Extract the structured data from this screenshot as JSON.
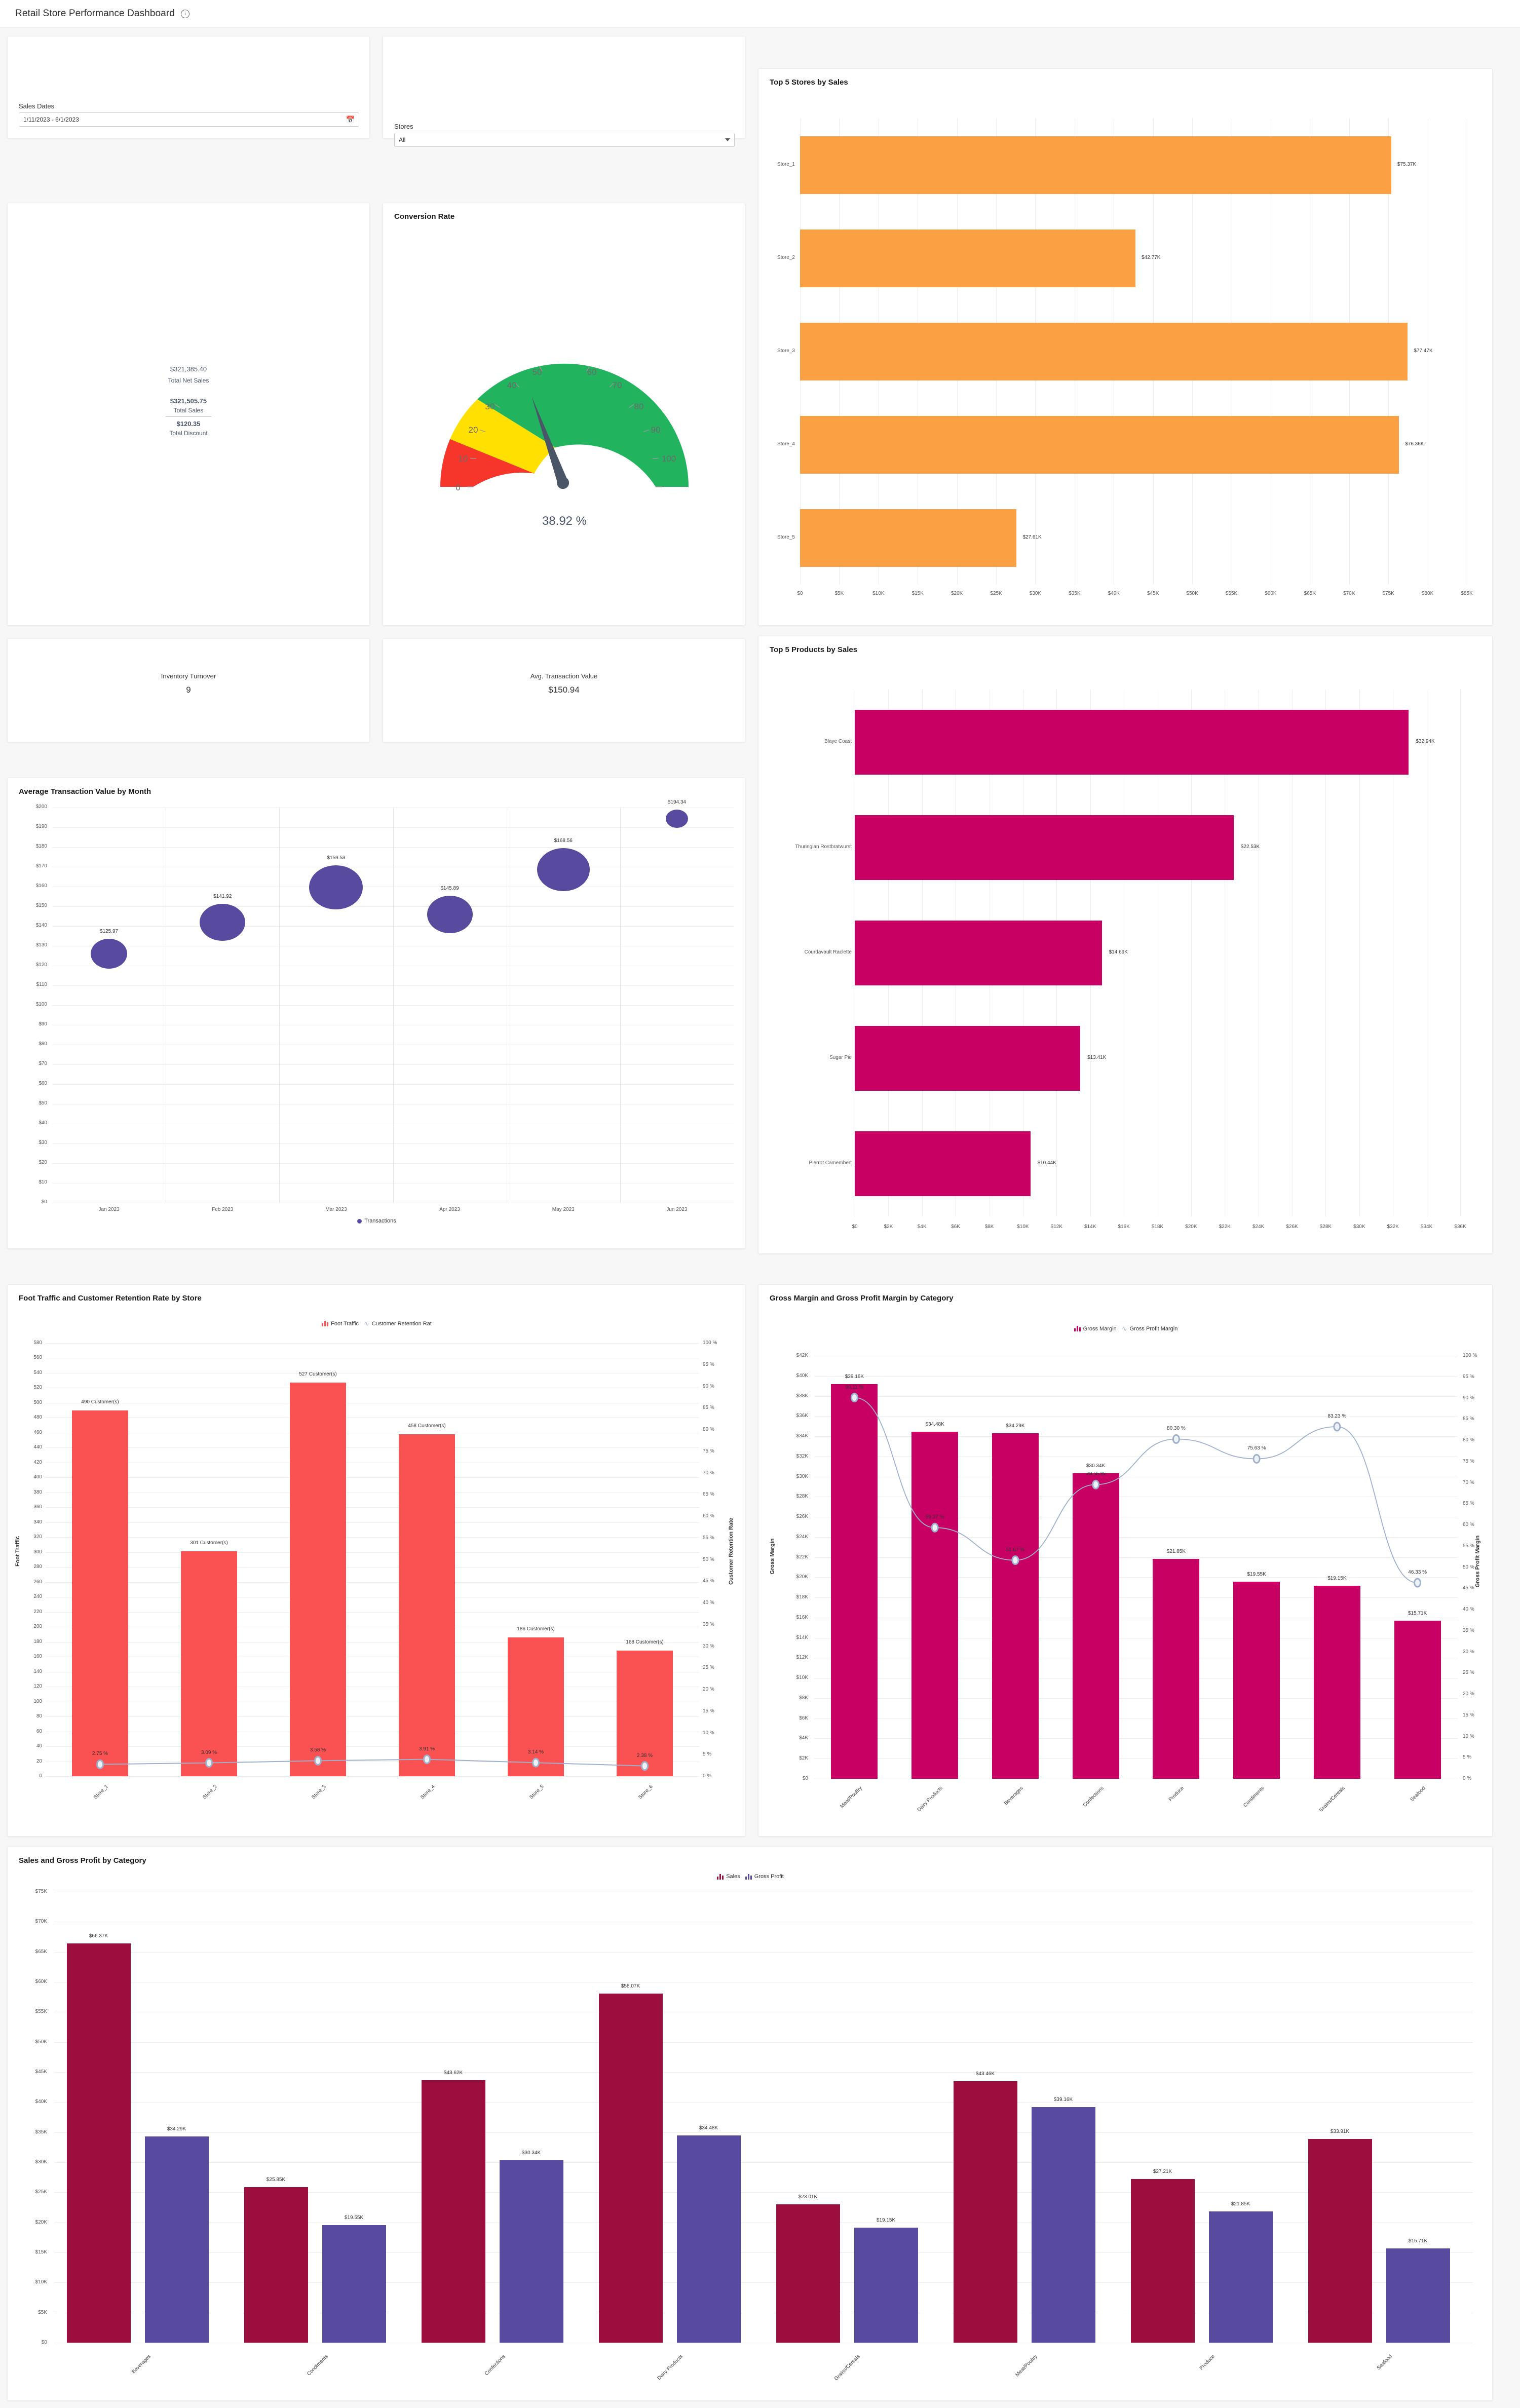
{
  "header": {
    "title": "Retail Store Performance Dashboard",
    "info_icon": "info-icon"
  },
  "filters": {
    "sales_dates": {
      "label": "Sales Dates",
      "value": "1/11/2023 - 6/1/2023",
      "icon": "calendar-icon"
    },
    "stores": {
      "label": "Stores",
      "value": "All",
      "icon": "chevron-down-icon"
    }
  },
  "kpis": {
    "net_sales_value": "$321,385.40",
    "net_sales_label": "Total Net Sales",
    "total_sales_value": "$321,505.75",
    "total_sales_label": "Total Sales",
    "discount_value": "$120.35",
    "discount_label": "Total Discount",
    "inventory_turnover_label": "Inventory Turnover",
    "inventory_turnover_value": "9",
    "atv_label": "Avg. Transaction Value",
    "atv_value": "$150.94"
  },
  "cards": {
    "conversion_rate": "Conversion Rate",
    "top_stores": "Top 5 Stores by Sales",
    "top_products": "Top 5 Products by Sales",
    "atv_month": "Average Transaction Value by Month",
    "foot_traffic": "Foot Traffic and Customer Retention Rate by Store",
    "gross_margin": "Gross Margin and Gross Profit Margin by Category",
    "sales_profit": "Sales and Gross Profit by Category"
  },
  "chart_data": [
    {
      "id": "conversion-gauge",
      "type": "gauge",
      "title": "Conversion Rate",
      "value": 38.92,
      "value_label": "38.92 %",
      "min": 0,
      "max": 100,
      "ticks": [
        0,
        10,
        20,
        30,
        40,
        50,
        60,
        70,
        80,
        90,
        100
      ],
      "bands": [
        {
          "from": 0,
          "to": 10,
          "color": "#f6352b"
        },
        {
          "from": 10,
          "to": 20,
          "color": "#ffe000"
        },
        {
          "from": 20,
          "to": 100,
          "color": "#22b35e"
        }
      ],
      "needle_color": "#4a5568"
    },
    {
      "id": "top-stores",
      "type": "bar",
      "orientation": "horizontal",
      "title": "Top 5 Stores by Sales",
      "categories": [
        "Store_1",
        "Store_2",
        "Store_3",
        "Store_4",
        "Store_5"
      ],
      "values": [
        75370,
        42770,
        77470,
        76360,
        27610
      ],
      "value_labels": [
        "$75.37K",
        "$42.77K",
        "$77.47K",
        "$76.36K",
        "$27.61K"
      ],
      "color": "#fca044",
      "xlim": [
        0,
        85000
      ],
      "xticks": [
        "$0",
        "$5K",
        "$10K",
        "$15K",
        "$20K",
        "$25K",
        "$30K",
        "$35K",
        "$40K",
        "$45K",
        "$50K",
        "$55K",
        "$60K",
        "$65K",
        "$70K",
        "$75K",
        "$80K",
        "$85K"
      ],
      "grid": true
    },
    {
      "id": "top-products",
      "type": "bar",
      "orientation": "horizontal",
      "title": "Top 5 Products by Sales",
      "categories": [
        "Blaye Coast",
        "Thuringian Rostbratwurst",
        "Courdavault Raclette",
        "Sugar Pie",
        "Pierrot Camembert"
      ],
      "values": [
        32940,
        22530,
        14690,
        13410,
        10440
      ],
      "value_labels": [
        "$32.94K",
        "$22.53K",
        "$14.69K",
        "$13.41K",
        "$10.44K"
      ],
      "color": "#c80063",
      "xlim": [
        0,
        36000
      ],
      "xticks": [
        "$0",
        "$2K",
        "$4K",
        "$6K",
        "$8K",
        "$10K",
        "$12K",
        "$14K",
        "$16K",
        "$18K",
        "$20K",
        "$22K",
        "$24K",
        "$26K",
        "$28K",
        "$30K",
        "$32K",
        "$34K",
        "$36K"
      ],
      "grid": true
    },
    {
      "id": "atv-by-month",
      "type": "scatter",
      "title": "Average Transaction Value by Month",
      "categories": [
        "Jan 2023",
        "Feb 2023",
        "Mar 2023",
        "Apr 2023",
        "May 2023",
        "Jun 2023"
      ],
      "values": [
        125.97,
        141.92,
        159.53,
        145.89,
        168.56,
        194.34
      ],
      "value_labels": [
        "$125.97",
        "$141.92",
        "$159.53",
        "$145.89",
        "$168.56",
        "$194.34"
      ],
      "bubble_sizes": [
        36,
        45,
        53,
        45,
        52,
        22
      ],
      "color": "#584a9e",
      "ylim": [
        0,
        200
      ],
      "yticks": [
        "$0",
        "$10",
        "$20",
        "$30",
        "$40",
        "$50",
        "$60",
        "$70",
        "$80",
        "$90",
        "$100",
        "$110",
        "$120",
        "$130",
        "$140",
        "$150",
        "$160",
        "$170",
        "$180",
        "$190",
        "$200"
      ],
      "legend": [
        "Transactions"
      ],
      "grid": true
    },
    {
      "id": "foot-traffic-retention",
      "type": "bar",
      "title": "Foot Traffic and Customer Retention Rate by Store",
      "categories": [
        "Store_1",
        "Store_2",
        "Store_3",
        "Store_4",
        "Store_5",
        "Store_6"
      ],
      "series": [
        {
          "name": "Foot Traffic",
          "type": "bar",
          "color": "#fa5252",
          "values": [
            490,
            301,
            527,
            458,
            186,
            168
          ],
          "value_labels": [
            "490 Customer(s)",
            "301 Customer(s)",
            "527 Customer(s)",
            "458 Customer(s)",
            "186 Customer(s)",
            "168 Customer(s)"
          ]
        },
        {
          "name": "Customer Retention Rat",
          "type": "line",
          "color": "#9db0cc",
          "values": [
            2.75,
            3.09,
            3.58,
            3.91,
            3.14,
            2.38
          ],
          "value_labels": [
            "2.75 %",
            "3.09 %",
            "3.58 %",
            "3.91 %",
            "3.14 %",
            "2.38 %"
          ]
        }
      ],
      "ylabel": "Foot Traffic",
      "y2label": "Customer Retention Rate",
      "ylim": [
        0,
        580
      ],
      "yticks": [
        "0",
        "20",
        "40",
        "60",
        "80",
        "100",
        "120",
        "140",
        "160",
        "180",
        "200",
        "220",
        "240",
        "260",
        "280",
        "300",
        "320",
        "340",
        "360",
        "380",
        "400",
        "420",
        "440",
        "460",
        "480",
        "500",
        "520",
        "540",
        "560",
        "580"
      ],
      "y2lim": [
        0,
        100
      ],
      "y2ticks": [
        "0 %",
        "5 %",
        "10 %",
        "15 %",
        "20 %",
        "25 %",
        "30 %",
        "35 %",
        "40 %",
        "45 %",
        "50 %",
        "55 %",
        "60 %",
        "65 %",
        "70 %",
        "75 %",
        "80 %",
        "85 %",
        "90 %",
        "95 %",
        "100 %"
      ],
      "grid": true
    },
    {
      "id": "gross-margin-category",
      "type": "bar",
      "title": "Gross Margin and Gross Profit Margin by Category",
      "categories": [
        "Meat/Poultry",
        "Dairy Products",
        "Beverages",
        "Confections",
        "Produce",
        "Condiments",
        "Grains/Cereals",
        "Seafood"
      ],
      "series": [
        {
          "name": "Gross Margin",
          "type": "bar",
          "color": "#c80063",
          "values": [
            39160,
            34480,
            34290,
            30340,
            21850,
            19550,
            19150,
            15710
          ],
          "value_labels": [
            "$39.16K",
            "$34.48K",
            "$34.29K",
            "$30.34K",
            "$21.85K",
            "$19.55K",
            "$19.15K",
            "$15.71K"
          ]
        },
        {
          "name": "Gross Profit Margin",
          "type": "line",
          "color": "#9db0cc",
          "values": [
            90.11,
            59.37,
            51.67,
            69.55,
            80.3,
            75.63,
            83.23,
            46.33
          ],
          "value_labels": [
            "90.11 %",
            "59.37 %",
            "51.67 %",
            "69.55 %",
            "80.30 %",
            "75.63 %",
            "83.23 %",
            "46.33 %"
          ]
        }
      ],
      "ylabel": "Gross Margin",
      "y2label": "Gross Profit Margin",
      "ylim": [
        0,
        42000
      ],
      "yticks": [
        "$0",
        "$2K",
        "$4K",
        "$6K",
        "$8K",
        "$10K",
        "$12K",
        "$14K",
        "$16K",
        "$18K",
        "$20K",
        "$22K",
        "$24K",
        "$26K",
        "$28K",
        "$30K",
        "$32K",
        "$34K",
        "$36K",
        "$38K",
        "$40K",
        "$42K"
      ],
      "y2lim": [
        0,
        100
      ],
      "y2ticks": [
        "0 %",
        "5 %",
        "10 %",
        "15 %",
        "20 %",
        "25 %",
        "30 %",
        "35 %",
        "40 %",
        "45 %",
        "50 %",
        "55 %",
        "60 %",
        "65 %",
        "70 %",
        "75 %",
        "80 %",
        "85 %",
        "90 %",
        "95 %",
        "100 %"
      ],
      "grid": true
    },
    {
      "id": "sales-gross-profit-category",
      "type": "bar",
      "title": "Sales and Gross Profit by Category",
      "categories": [
        "Beverages",
        "Condiments",
        "Confections",
        "Dairy Products",
        "Grains/Cereals",
        "Meat/Poultry",
        "Produce",
        "Seafood"
      ],
      "series": [
        {
          "name": "Sales",
          "type": "bar",
          "color": "#9b0e3e",
          "values": [
            66370,
            25850,
            43620,
            58070,
            23010,
            43460,
            27210,
            33910
          ],
          "value_labels": [
            "$66.37K",
            "$25.85K",
            "$43.62K",
            "$58.07K",
            "$23.01K",
            "$43.46K",
            "$27.21K",
            "$33.91K"
          ]
        },
        {
          "name": "Gross Profit",
          "type": "bar",
          "color": "#584a9e",
          "values": [
            34290,
            19550,
            30340,
            34480,
            19150,
            39160,
            21850,
            15710
          ],
          "value_labels": [
            "$34.29K",
            "$19.55K",
            "$30.34K",
            "$34.48K",
            "$19.15K",
            "$39.16K",
            "$21.85K",
            "$15.71K"
          ]
        }
      ],
      "ylim": [
        0,
        75000
      ],
      "yticks": [
        "$0",
        "$5K",
        "$10K",
        "$15K",
        "$20K",
        "$25K",
        "$30K",
        "$35K",
        "$40K",
        "$45K",
        "$50K",
        "$55K",
        "$60K",
        "$65K",
        "$70K",
        "$75K"
      ],
      "grid": true
    }
  ],
  "colors": {
    "orange": "#fca044",
    "magenta": "#c80063",
    "purple": "#584a9e",
    "red": "#fa5252",
    "maroon": "#9b0e3e",
    "line_blue": "#9db0cc",
    "green": "#22b35e",
    "yellow": "#ffe000",
    "red_band": "#f6352b"
  }
}
